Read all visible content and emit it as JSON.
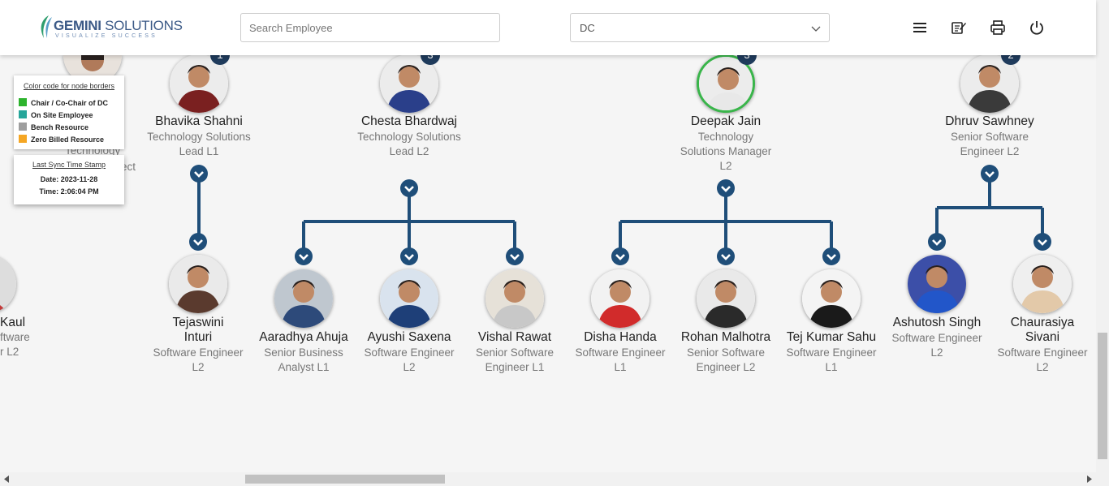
{
  "header": {
    "logo_name_bold": "GEMINI",
    "logo_name_rest": " SOLUTIONS",
    "logo_tagline": "VISUALIZE SUCCESS",
    "search_placeholder": "Search Employee",
    "dc_select_value": "DC"
  },
  "legend": {
    "title": "Color code for node borders",
    "items": [
      {
        "label": "Chair / Co-Chair of DC",
        "color": "#2db32d"
      },
      {
        "label": "On Site Employee",
        "color": "#26a69a"
      },
      {
        "label": "Bench Resource",
        "color": "#9e9e9e"
      },
      {
        "label": "Zero Billed Resource",
        "color": "#f5a623"
      }
    ]
  },
  "sync": {
    "title": "Last Sync Time Stamp",
    "date_line": "Date: 2023-11-28",
    "time_line": "Time: 2:06:04 PM"
  },
  "partial_behind": {
    "role_a": "Technology",
    "role_b": "ect"
  },
  "managers": [
    {
      "name": "Bhavika Shahni",
      "role": "Technology Solutions Lead L1",
      "reports": "1",
      "border": "none"
    },
    {
      "name": "Chesta Bhardwaj",
      "role": "Technology Solutions Lead L2",
      "reports": "3",
      "border": "none"
    },
    {
      "name": "Deepak Jain",
      "role": "Technology Solutions Manager L2",
      "reports": "3",
      "border": "chair"
    },
    {
      "name": "Dhruv Sawhney",
      "role": "Senior Software Engineer L2",
      "reports": "2",
      "border": "none"
    }
  ],
  "partial_left_child": {
    "name": "Kaul",
    "role_line1": "ftware",
    "role_line2": "r L2"
  },
  "reports": [
    {
      "name": "Tejaswini Inturi",
      "role": "Software Engineer L2"
    },
    {
      "name": "Aaradhya Ahuja",
      "role": "Senior Business Analyst L1"
    },
    {
      "name": "Ayushi Saxena",
      "role": "Software Engineer L2"
    },
    {
      "name": "Vishal Rawat",
      "role": "Senior Software Engineer L1"
    },
    {
      "name": "Disha Handa",
      "role": "Software Engineer L1"
    },
    {
      "name": "Rohan Malhotra",
      "role": "Senior Software Engineer L2"
    },
    {
      "name": "Tej Kumar Sahu",
      "role": "Software Engineer L1"
    },
    {
      "name": "Ashutosh Singh",
      "role": "Software Engineer L2"
    },
    {
      "name": "Chaurasiya Sivani",
      "role": "Software Engineer L2"
    }
  ],
  "colors": {
    "connector": "#1f4e79",
    "badge": "#1f3b5c",
    "chair_border": "#39b54a"
  },
  "icons": {
    "menu": "hamburger-icon",
    "notes": "edit-notes-icon",
    "print": "printer-icon",
    "power": "power-icon"
  }
}
